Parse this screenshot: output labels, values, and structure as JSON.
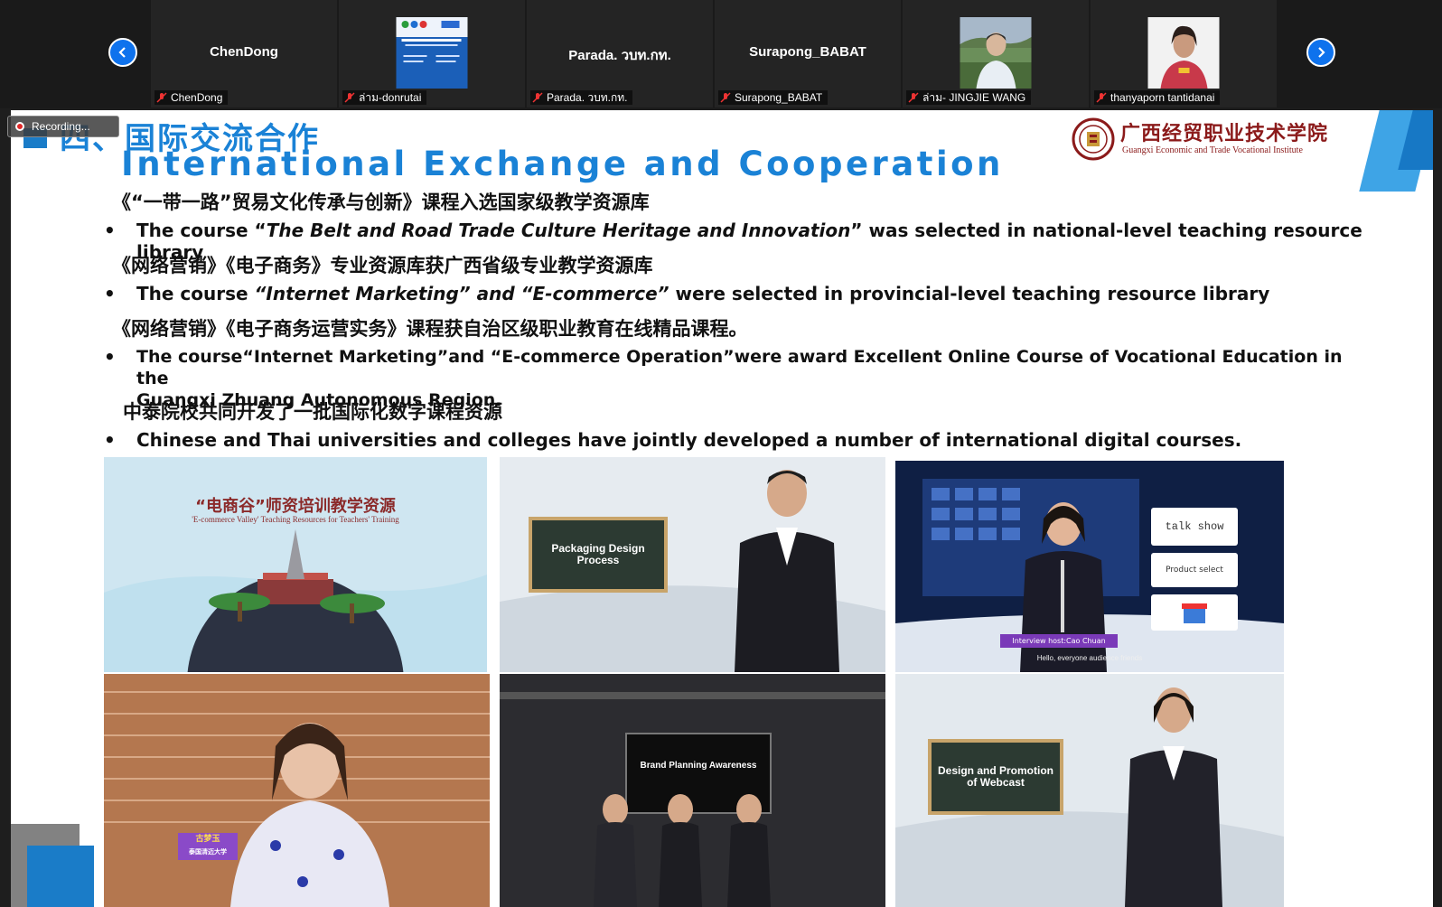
{
  "meeting": {
    "recording_label": "Recording...",
    "participants": [
      {
        "display_name": "ChenDong",
        "label": "ChenDong",
        "has_video": false
      },
      {
        "display_name": "",
        "label": "ล่าม-donrutai",
        "has_video": true
      },
      {
        "display_name": "Parada. วบท.กท.",
        "label": "Parada. วบท.กท.",
        "has_video": false
      },
      {
        "display_name": "Surapong_BABAT",
        "label": "Surapong_BABAT",
        "has_video": false
      },
      {
        "display_name": "",
        "label": "ล่าม- JINGJIE WANG",
        "has_video": true
      },
      {
        "display_name": "",
        "label": "thanyaporn tantidanai",
        "has_video": true
      }
    ]
  },
  "slide": {
    "title_cn": "四、国际交流合作",
    "title_en": "International Exchange and Cooperation",
    "logo": {
      "name_cn": "广西经贸职业技术学院",
      "name_en": "Guangxi Economic and Trade Vocational Institute"
    },
    "items": [
      {
        "cn": "《“一带一路”贸易文化传承与创新》课程入选国家级教学资源库",
        "en_prefix": "The course “",
        "en_italic": "The Belt and Road Trade Culture Heritage and Innovation",
        "en_suffix": "”   was selected in national-level teaching resource library"
      },
      {
        "cn": "《网络营销》《电子商务》专业资源库获广西省级专业教学资源库",
        "en_prefix": "The course  ",
        "en_italic": "“Internet Marketing”  and  “E-commerce”",
        "en_suffix": "  were selected in provincial-level teaching resource library"
      },
      {
        "cn": "《网络营销》《电子商务运营实务》课程获自治区级职业教育在线精品课程。",
        "en_line1": "The course“Internet Marketing”and  “E-commerce Operation”were award Excellent Online Course of Vocational Education in the",
        "en_line2": "Guangxi Zhuang Autonomous Region."
      },
      {
        "cn": "中泰院校共同开发了一批国际化数字课程资源",
        "en": "Chinese and Thai universities and colleges have jointly developed a number of international digital courses."
      }
    ],
    "bullet": "•",
    "thumbnails": {
      "t1_title": "“电商谷”师资培训教学资源",
      "t1_subtitle": "'E-commerce Valley' Teaching Resources for Teachers' Training",
      "t2_board": "Packaging Design Process",
      "t3_board1": "talk show",
      "t3_board2": "Product select",
      "t3_banner": "Interview host:Cao Chuan",
      "t3_caption": "Hello, everyone audience friends",
      "t4_name": "古梦玉",
      "t4_school": "泰国清迈大学",
      "t5_board": "Brand Planning Awareness",
      "t6_board": "Design and Promotion of Webcast"
    }
  }
}
